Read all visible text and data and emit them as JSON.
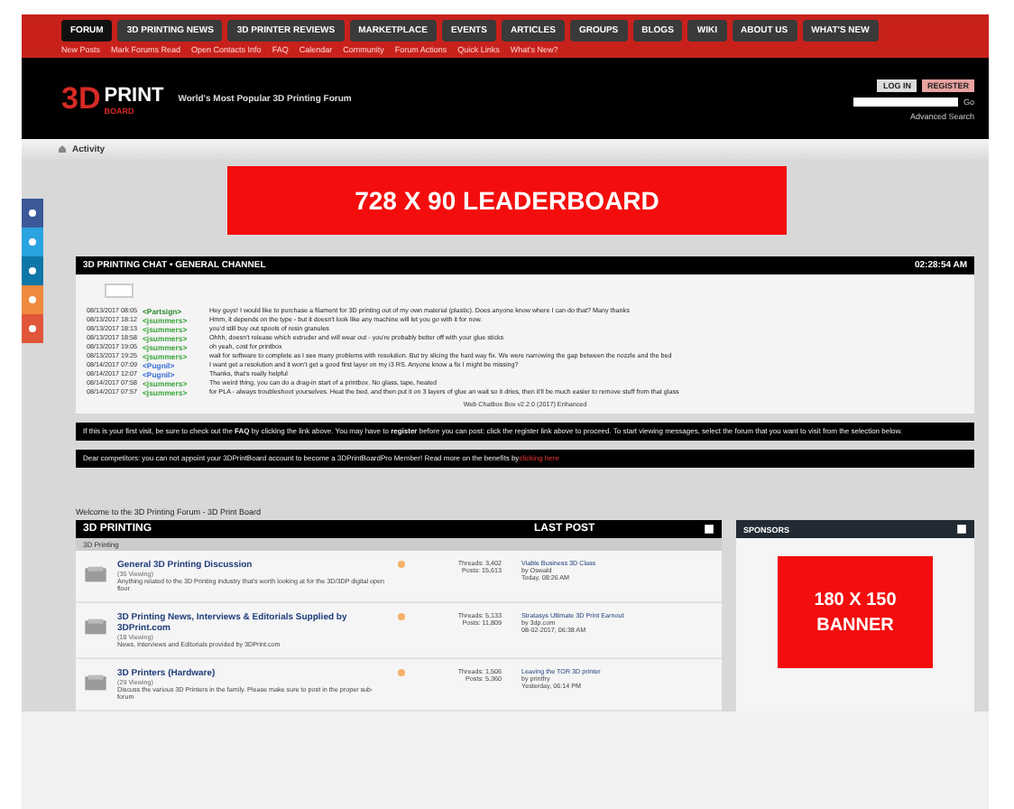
{
  "nav": {
    "tabs": [
      {
        "label": "FORUM",
        "selected": true
      },
      {
        "label": "3D PRINTING NEWS",
        "selected": false
      },
      {
        "label": "3D PRINTER REVIEWS",
        "selected": false
      },
      {
        "label": "MARKETPLACE",
        "selected": false
      },
      {
        "label": "EVENTS",
        "selected": false
      },
      {
        "label": "ARTICLES",
        "selected": false
      },
      {
        "label": "GROUPS",
        "selected": false
      },
      {
        "label": "BLOGS",
        "selected": false
      },
      {
        "label": "WIKI",
        "selected": false
      },
      {
        "label": "ABOUT US",
        "selected": false
      },
      {
        "label": "WHAT'S NEW",
        "selected": false
      }
    ],
    "links": [
      "New Posts",
      "Mark Forums Read",
      "Open Contacts Info",
      "FAQ",
      "Calendar",
      "Community",
      "Forum Actions",
      "Quick Links",
      "What's New?"
    ]
  },
  "header": {
    "logo_main": "3D",
    "logo_word": "PRINT",
    "logo_sub": "BOARD",
    "tagline": "World's Most Popular 3D Printing Forum",
    "login": "LOG IN",
    "register": "REGISTER",
    "go": "Go",
    "advanced_search": "Advanced Search"
  },
  "breadcrumb": "Activity",
  "leaderboard": "728 X 90 LEADERBOARD",
  "chat": {
    "title": "3D PRINTING CHAT • GENERAL CHANNEL",
    "time": "02:28:54 AM",
    "lines": [
      {
        "time": "08/13/2017 08:05",
        "user": "<Partsign>",
        "color": "#2e8b2e",
        "text": "Hey guys! I would like to purchase a filament for 3D printing out of my own material (plastic). Does anyone know where I can do that? Many thanks"
      },
      {
        "time": "08/13/2017 18:12",
        "user": "<jsummers>",
        "color": "#3aa53a",
        "text": "Hmm, it depends on the type - but it doesn't look like any machine will let you go with it for now."
      },
      {
        "time": "08/13/2017 18:13",
        "user": "<jsummers>",
        "color": "#3aa53a",
        "text": "you'd still buy out spools of resin granules"
      },
      {
        "time": "08/13/2017 18:58",
        "user": "<jsummers>",
        "color": "#3aa53a",
        "text": "Ohhh, doesn't release which extruder and will wear out - you're probably better off with your glue sticks"
      },
      {
        "time": "08/13/2017 19:05",
        "user": "<jsummers>",
        "color": "#3aa53a",
        "text": "oh yeah, cost for printbox"
      },
      {
        "time": "08/13/2017 19:25",
        "user": "<jsummers>",
        "color": "#3aa53a",
        "text": "wait for software to complete as I see many problems with resolution. But try slicing the hard way fix. We were narrowing the gap between the nozzle and the bed"
      },
      {
        "time": "08/14/2017 07:09",
        "user": "<Pugnil>",
        "color": "#3a6fd8",
        "text": "I want get a resolution and it won't get a good first layer on my i3 RS. Anyone know a fix I might be missing?"
      },
      {
        "time": "08/14/2017 12:07",
        "user": "<Pugnil>",
        "color": "#3a6fd8",
        "text": "Thanks, that's really helpful"
      },
      {
        "time": "08/14/2017 07:58",
        "user": "<jsummers>",
        "color": "#3aa53a",
        "text": "The weird thing, you can do a drag-in start of a printbox. No glass, tape, heated"
      },
      {
        "time": "08/14/2017 07:57",
        "user": "<jsummers>",
        "color": "#3aa53a",
        "text": "for PLA - always troubleshoot yourselves. Heat the bed, and then put it on 3 layers of glue an wait so it dries, then it'll be much easier to remove stuff from that glass"
      }
    ],
    "footer": "Web Chatbox Box v2.2.0 (2017) Enhanced"
  },
  "notices": [
    {
      "text": "If this is your first visit, be sure to check out the **FAQ** by clicking the link above. You may have to **register** before you can post: click the register link above to proceed. To start viewing messages, select the forum that you want to visit from the selection below."
    },
    {
      "text": "Dear competitors: you can not appoint your 3DPrintBoard account to become a 3DPrintBoardPro Member! Read more on the benefits by",
      "link": "clicking here"
    }
  ],
  "welcome": "Welcome to the 3D Printing Forum - 3D Print Board",
  "forum": {
    "title": "3D PRINTING",
    "last_post": "LAST POST",
    "section": "3D Printing",
    "rows": [
      {
        "title": "General 3D Printing Discussion",
        "viewing": "(35 Viewing)",
        "desc": "Anything related to the 3D Printing industry that's worth looking at for the 3D/3DP digital open floor",
        "threads": "Threads: 3,402",
        "posts": "Posts: 15,613",
        "lp_title": "Viable Business 3D Class",
        "lp_by": "by Oswald",
        "lp_date": "Today, 08:26 AM"
      },
      {
        "title": "3D Printing News, Interviews & Editorials Supplied by 3DPrint.com",
        "viewing": "(18 Viewing)",
        "desc": "News, Interviews and Editorials provided by 3DPrint.com",
        "threads": "Threads: 5,133",
        "posts": "Posts: 11,809",
        "lp_title": "Stratasys Ultimate 3D Print Earnout",
        "lp_by": "by 3dp.com",
        "lp_date": "08-02-2017, 06:38 AM"
      },
      {
        "title": "3D Printers (Hardware)",
        "viewing": "(29 Viewing)",
        "desc": "Discuss the various 3D Printers in the family. Please make sure to post in the proper sub-forum",
        "threads": "Threads: 1,506",
        "posts": "Posts: 5,360",
        "lp_title": "Leaving the TOR 3D printer",
        "lp_by": "by printfry",
        "lp_date": "Yesterday, 06:14 PM"
      }
    ]
  },
  "sponsors": {
    "title": "SPONSORS",
    "banner_top": "180 X 150",
    "banner_bottom": "BANNER"
  }
}
